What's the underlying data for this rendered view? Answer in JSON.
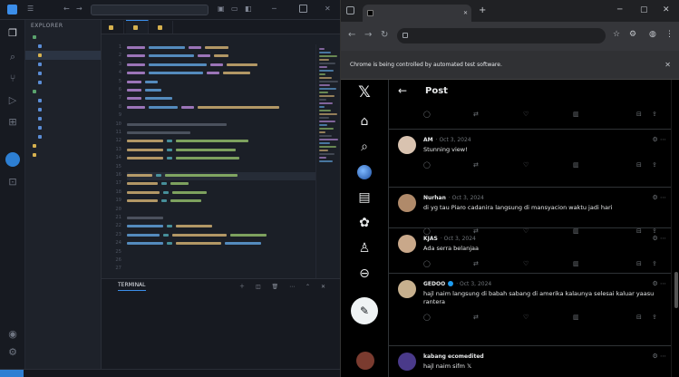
{
  "vscode": {
    "search_text": "",
    "sidebar_header": "EXPLORER",
    "sidebar_items": [
      {
        "label": "",
        "level": 1
      },
      {
        "label": "",
        "level": 2
      },
      {
        "label": "",
        "level": 2,
        "selected": true
      },
      {
        "label": "",
        "level": 2
      },
      {
        "label": "",
        "level": 2
      },
      {
        "label": "",
        "level": 2
      },
      {
        "label": "",
        "level": 1
      },
      {
        "label": "",
        "level": 2
      },
      {
        "label": "",
        "level": 2
      },
      {
        "label": "",
        "level": 2
      },
      {
        "label": "",
        "level": 2
      },
      {
        "label": "",
        "level": 2
      },
      {
        "label": "",
        "level": 1
      },
      {
        "label": "",
        "level": 1
      }
    ],
    "tabs": [
      "",
      "",
      ""
    ],
    "breadcrumb": "",
    "panel_tabs": [
      "",
      "TERMINAL"
    ],
    "terminal_selector": "",
    "terminal_lines": [
      "",
      "",
      "",
      "",
      "",
      "",
      "",
      "",
      "",
      "",
      "",
      "",
      ""
    ],
    "status": ""
  },
  "browser": {
    "tab_title": "",
    "url": "",
    "infobar_text": "Chrome is being controlled by automated test software."
  },
  "x": {
    "page_title": "Post",
    "top_actions": {
      "replies": "",
      "reposts": "",
      "likes": "",
      "views": ""
    },
    "replies": [
      {
        "name": "AM",
        "meta": "· Oct 3, 2024",
        "text": "Stunning view!",
        "views": ""
      },
      {
        "name": "Nurhan",
        "meta": "· Oct 3, 2024",
        "text": "di yg tau Piaro cadanira langsung di mansyacion waktu jadi hari",
        "views": ""
      },
      {
        "name": "KJAS",
        "meta": "· Oct 3, 2024",
        "text": "Ada serra belanjaa",
        "views": ""
      },
      {
        "name": "GEDOO",
        "meta": "· Oct 3, 2024",
        "text": "hajl naim langsung di babah sabang di amerika kalaunya selesai kaluar yaasu rantera",
        "views": ""
      },
      {
        "name": "kabang ecomedited",
        "meta": "",
        "text": "hajl naim sifm 𝕏",
        "views": ""
      }
    ]
  }
}
